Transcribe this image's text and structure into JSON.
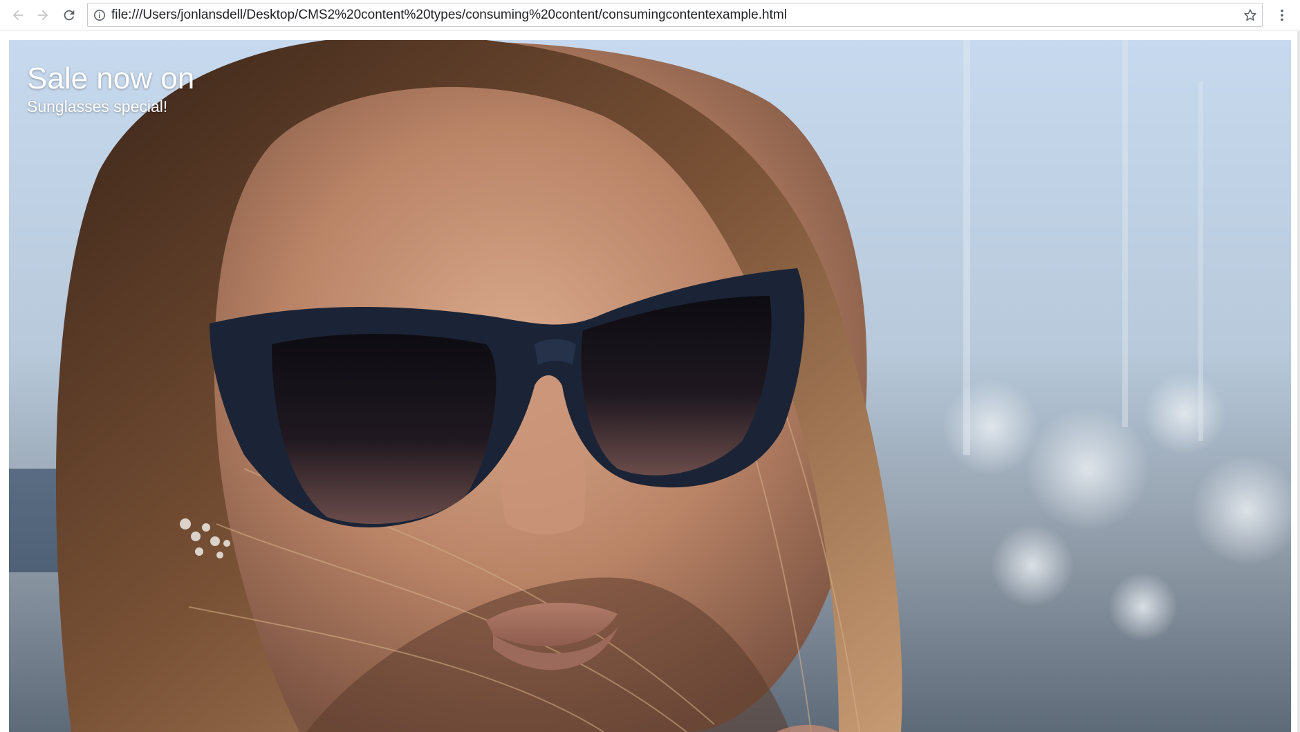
{
  "browser": {
    "url": "file:///Users/jonlansdell/Desktop/CMS2%20content%20types/consuming%20content/consumingcontentexample.html",
    "icons": {
      "back": "arrow-left-icon",
      "forward": "arrow-right-icon",
      "reload": "reload-icon",
      "info": "info-icon",
      "bookmark": "star-icon",
      "menu": "kebab-menu-icon"
    }
  },
  "page": {
    "hero": {
      "title": "Sale now on",
      "subtitle": "Sunglasses special!",
      "image": "woman-wearing-sunglasses-photo"
    }
  },
  "colors": {
    "hero_text": "#ffffff",
    "sky": "#c9dcef",
    "sunglasses_frame": "#1b2436"
  }
}
